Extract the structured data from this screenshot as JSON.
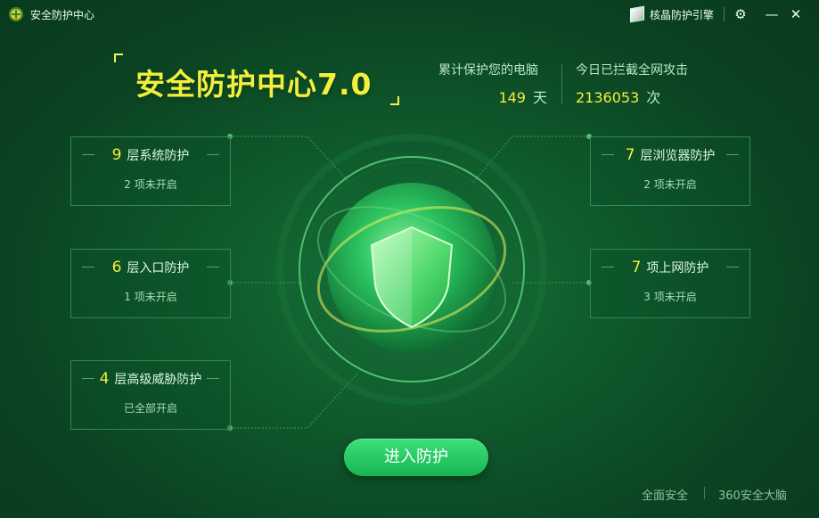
{
  "window": {
    "title": "安全防护中心",
    "engine_button": "核晶防护引擎",
    "icons": {
      "app": "360-logo-icon",
      "engine": "cube-icon",
      "settings": "gear-icon",
      "minimize": "minimize-icon",
      "close": "close-icon"
    }
  },
  "hero": {
    "title": "安全防护中心7.0"
  },
  "stats": {
    "days_caption": "累计保护您的电脑",
    "days_value": "149",
    "days_unit": "天",
    "attacks_caption": "今日已拦截全网攻击",
    "attacks_value": "2136053",
    "attacks_unit": "次"
  },
  "cards": {
    "system": {
      "num": "9",
      "label": "层系统防护",
      "status": "2 项未开启"
    },
    "entry": {
      "num": "6",
      "label": "层入口防护",
      "status": "1 项未开启"
    },
    "threat": {
      "num": "4",
      "label": "层高级威胁防护",
      "status": "已全部开启"
    },
    "browser": {
      "num": "7",
      "label": "层浏览器防护",
      "status": "2 项未开启"
    },
    "internet": {
      "num": "7",
      "label": "项上网防护",
      "status": "3 项未开启"
    }
  },
  "center": {
    "icon": "shield-icon"
  },
  "actions": {
    "enter": "进入防护"
  },
  "footer": {
    "left": "全面安全",
    "right": "360安全大脑"
  },
  "colors": {
    "accent_yellow": "#f2ef3d",
    "button_green": "#2ad06a",
    "bg_dark": "#0b4322"
  }
}
